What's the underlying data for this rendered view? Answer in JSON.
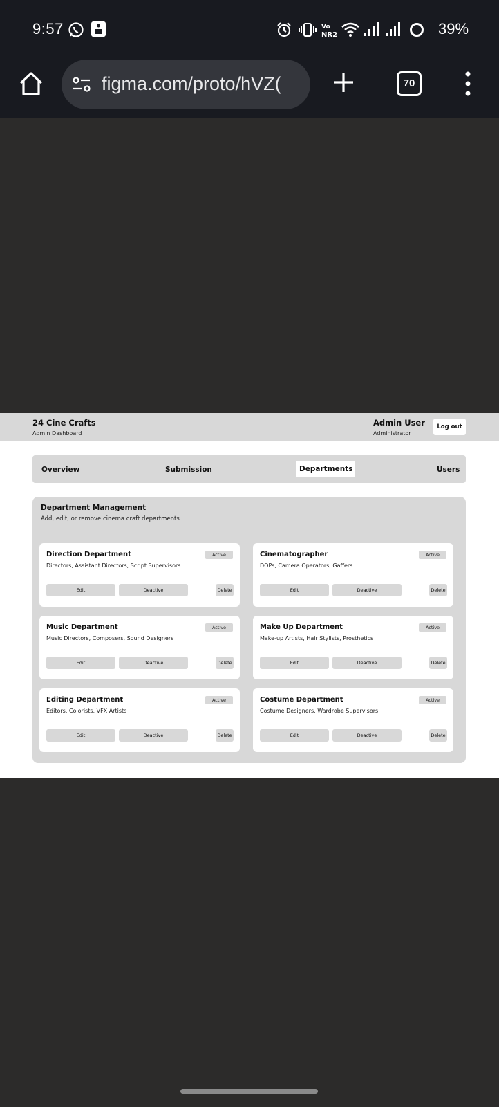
{
  "status_bar": {
    "time": "9:57",
    "battery": "39%",
    "icons": [
      "whatsapp-icon",
      "notification-icon",
      "alarm-icon",
      "vibrate-icon",
      "vonr-icon",
      "wifi-icon",
      "signal-icon",
      "signal-icon",
      "battery-icon"
    ]
  },
  "browser": {
    "url": "figma.com/proto/hVZ(",
    "tab_count": "70"
  },
  "app": {
    "brand_title": "24 Cine Crafts",
    "brand_subtitle": "Admin Dashboard",
    "user_name": "Admin User",
    "user_role": "Administrator",
    "logout_label": "Log out",
    "tabs": [
      {
        "label": "Overview",
        "active": false
      },
      {
        "label": "Submission",
        "active": false
      },
      {
        "label": "Departments",
        "active": true
      },
      {
        "label": "Users",
        "active": false
      }
    ],
    "panel_title": "Department Management",
    "panel_subtitle": "Add, edit, or remove cinema craft departments",
    "cards": [
      {
        "title": "Direction Department",
        "desc": "Directors, Assistant Directors, Script Supervisors",
        "status": "Active",
        "edit": "Edit",
        "deactivate": "Deactive",
        "delete": "Delete"
      },
      {
        "title": "Cinematographer",
        "desc": "DOPs, Camera Operators, Gaffers",
        "status": "Active",
        "edit": "Edit",
        "deactivate": "Deactive",
        "delete": "Delete"
      },
      {
        "title": "Music Department",
        "desc": "Music Directors, Composers, Sound Designers",
        "status": "Active",
        "edit": "Edit",
        "deactivate": "Deactive",
        "delete": "Delete"
      },
      {
        "title": "Make Up Department",
        "desc": "Make-up Artists, Hair Stylists, Prosthetics",
        "status": "Active",
        "edit": "Edit",
        "deactivate": "Deactive",
        "delete": "Delete"
      },
      {
        "title": "Editing Department",
        "desc": "Editors, Colorists, VFX Artists",
        "status": "Active",
        "edit": "Edit",
        "deactivate": "Deactive",
        "delete": "Delete"
      },
      {
        "title": "Costume Department",
        "desc": "Costume Designers, Wardrobe Supervisors",
        "status": "Active",
        "edit": "Edit",
        "deactivate": "Deactive",
        "delete": "Delete"
      }
    ]
  }
}
